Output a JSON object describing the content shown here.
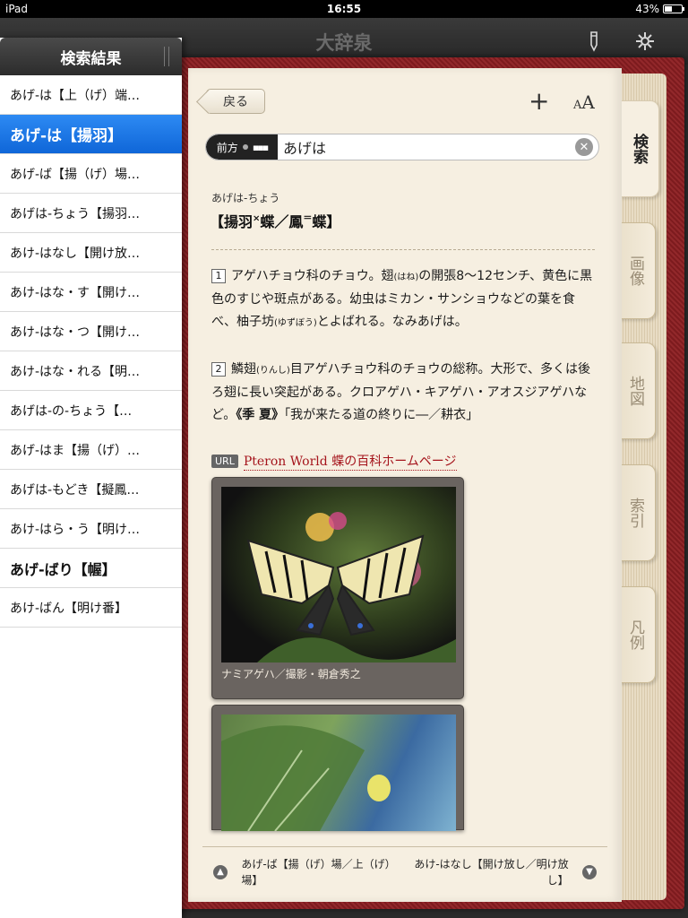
{
  "status_bar": {
    "device": "iPad",
    "time": "16:55",
    "battery": "43%",
    "battery_level": 0.43
  },
  "nav": {
    "title": "大辞泉",
    "pen_icon": "pen-icon",
    "settings_icon": "gear-icon"
  },
  "sidebar": {
    "title": "検索結果",
    "results": [
      "あげ‐は【上（げ）端…",
      "あげ‐は【揚羽】",
      "あげ‐ば【揚（げ）場…",
      "あげは‐ちょう【揚羽…",
      "あけ‐はなし【開け放…",
      "あけ‐はな・す【開け…",
      "あけ‐はな・つ【開け…",
      "あけ‐はな・れる【明…",
      "あげは‐の‐ちょう【…",
      "あげ‐はま【揚（げ）…",
      "あげは‐もどき【擬鳳…",
      "あけ‐はら・う【明け…",
      "あげ‐ばり【幄】",
      "あけ‐ばん【明け番】"
    ]
  },
  "toolbar": {
    "back_label": "戻る",
    "add_label": "+",
    "font_small": "A",
    "font_large": "A"
  },
  "search": {
    "mode_label": "前方",
    "value": "あげは",
    "clear_label": "✕"
  },
  "tabs": [
    "検索",
    "画像",
    "地図",
    "索引",
    "凡例"
  ],
  "entry": {
    "reading": "あげは‐ちょう",
    "title_part1": "【揚羽",
    "title_mark1": "×",
    "title_part2": "蝶／鳳",
    "title_mark2": "＝",
    "title_part3": "蝶】",
    "def1_num": "1",
    "def1_a": "アゲハチョウ科のチョウ。翅",
    "def1_ruby": "(はね)",
    "def1_b": "の開張8〜12センチ、黄色に黒色のすじや斑点がある。幼虫はミカン・サンショウなどの葉を食べ、柚子坊",
    "def1_ruby2": "(ゆずぼう)",
    "def1_c": "とよばれる。なみあげは。",
    "def2_num": "2",
    "def2_a": "鱗翅",
    "def2_ruby": "(りんし)",
    "def2_b": "目アゲハチョウ科のチョウの総称。大形で、多くは後ろ翅に長い突起がある。クロアゲハ・キアゲハ・アオスジアゲハなど。",
    "def2_season": "《季 夏》",
    "def2_c": "「我が来たる道の終りに―／耕衣」",
    "url_badge": "URL",
    "url_text": "Pteron World 蝶の百科ホームページ",
    "image1_caption": "ナミアゲハ／撮影・朝倉秀之"
  },
  "footer": {
    "prev_label": "あげ‐ば【揚（げ）場／上（げ）場】",
    "next_label": "あけ‐はなし【開け放し／明け放し】"
  },
  "colors": {
    "selected": "#0f66d8",
    "cover": "#8e1f22",
    "link": "#a5141c",
    "paper": "#f6efe1"
  }
}
